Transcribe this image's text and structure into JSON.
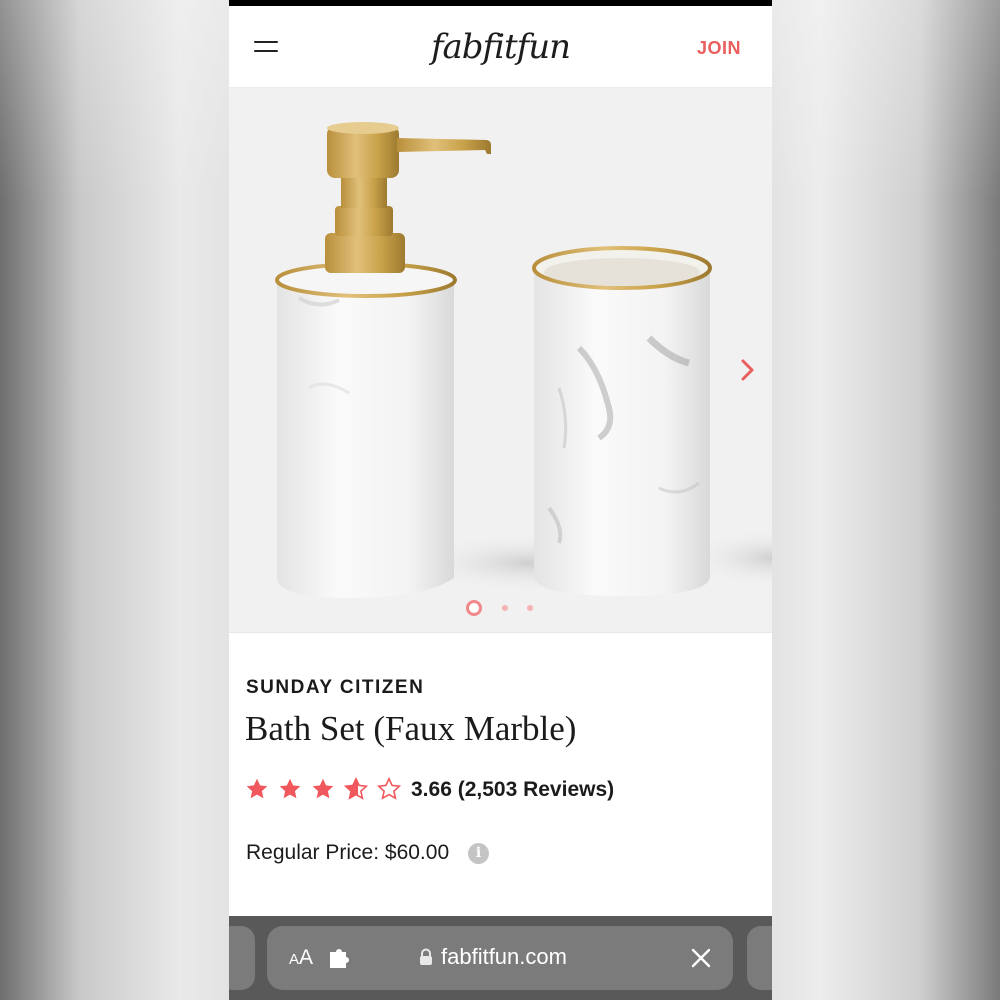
{
  "header": {
    "logo_text": "fabfitfun",
    "join_label": "JOIN"
  },
  "gallery": {
    "image_alt": "Gold pump soap dispenser and tumbler in white faux marble",
    "slide_count": 3,
    "active_slide": 1
  },
  "product": {
    "brand": "SUNDAY CITIZEN",
    "title": "Bath Set (Faux Marble)",
    "rating_value": 3.66,
    "rating_text": "3.66 (2,503 Reviews)",
    "price_text": "Regular Price: $60.00"
  },
  "browser": {
    "aa_small": "A",
    "aa_big": "A",
    "url": "fabfitfun.com"
  },
  "colors": {
    "accent": "#ea5e5e",
    "star": "#f0585d",
    "gold": "#c9a24a"
  },
  "icons": [
    "menu-icon",
    "chevron-right-icon",
    "star-icon",
    "info-icon",
    "extension-icon",
    "lock-icon",
    "close-icon"
  ]
}
